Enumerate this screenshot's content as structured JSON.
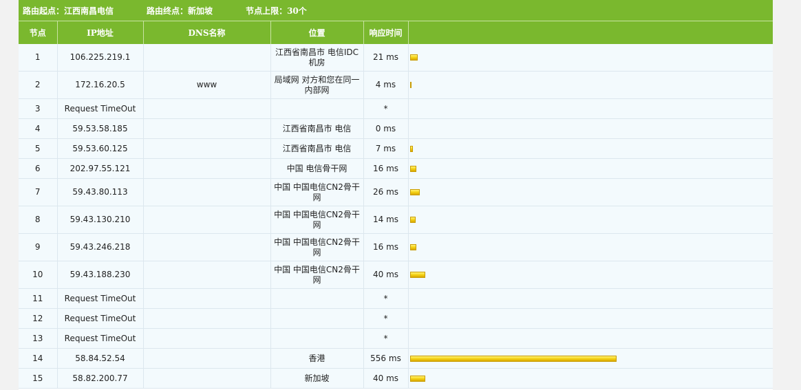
{
  "header": {
    "start_label": "路由起点：",
    "start_value": "江西南昌电信",
    "end_label": "路由终点：",
    "end_value": "新加坡",
    "limit_label": "节点上限：",
    "limit_value": "30个"
  },
  "columns": {
    "hop": "节点",
    "ip": "IP地址",
    "dns": "DNS名称",
    "location": "位置",
    "time": "响应时间"
  },
  "colors": {
    "header_green": "#7ab82e",
    "row_bg": "#f3fafd",
    "bar_yellow": "#f6d61a"
  },
  "bar_scale_ms": 556,
  "rows": [
    {
      "hop": "1",
      "ip": "106.225.219.1",
      "dns": "",
      "location": "江西省南昌市 电信IDC机房",
      "time": "21 ms",
      "ms": 21,
      "tall": true
    },
    {
      "hop": "2",
      "ip": "172.16.20.5",
      "dns": "www",
      "location": "局域网 对方和您在同一内部网",
      "time": "4 ms",
      "ms": 4,
      "tall": true
    },
    {
      "hop": "3",
      "ip": "Request TimeOut",
      "dns": "",
      "location": "",
      "time": "*",
      "ms": 0,
      "tall": false
    },
    {
      "hop": "4",
      "ip": "59.53.58.185",
      "dns": "",
      "location": "江西省南昌市 电信",
      "time": "0 ms",
      "ms": 0,
      "tall": false
    },
    {
      "hop": "5",
      "ip": "59.53.60.125",
      "dns": "",
      "location": "江西省南昌市 电信",
      "time": "7 ms",
      "ms": 7,
      "tall": false
    },
    {
      "hop": "6",
      "ip": "202.97.55.121",
      "dns": "",
      "location": "中国 电信骨干网",
      "time": "16 ms",
      "ms": 16,
      "tall": false
    },
    {
      "hop": "7",
      "ip": "59.43.80.113",
      "dns": "",
      "location": "中国 中国电信CN2骨干网",
      "time": "26 ms",
      "ms": 26,
      "tall": true
    },
    {
      "hop": "8",
      "ip": "59.43.130.210",
      "dns": "",
      "location": "中国 中国电信CN2骨干网",
      "time": "14 ms",
      "ms": 14,
      "tall": true
    },
    {
      "hop": "9",
      "ip": "59.43.246.218",
      "dns": "",
      "location": "中国 中国电信CN2骨干网",
      "time": "16 ms",
      "ms": 16,
      "tall": true
    },
    {
      "hop": "10",
      "ip": "59.43.188.230",
      "dns": "",
      "location": "中国 中国电信CN2骨干网",
      "time": "40 ms",
      "ms": 40,
      "tall": true
    },
    {
      "hop": "11",
      "ip": "Request TimeOut",
      "dns": "",
      "location": "",
      "time": "*",
      "ms": 0,
      "tall": false
    },
    {
      "hop": "12",
      "ip": "Request TimeOut",
      "dns": "",
      "location": "",
      "time": "*",
      "ms": 0,
      "tall": false
    },
    {
      "hop": "13",
      "ip": "Request TimeOut",
      "dns": "",
      "location": "",
      "time": "*",
      "ms": 0,
      "tall": false
    },
    {
      "hop": "14",
      "ip": "58.84.52.54",
      "dns": "",
      "location": "香港",
      "time": "556 ms",
      "ms": 556,
      "tall": false
    },
    {
      "hop": "15",
      "ip": "58.82.200.77",
      "dns": "",
      "location": "新加坡",
      "time": "40 ms",
      "ms": 40,
      "tall": false
    }
  ]
}
